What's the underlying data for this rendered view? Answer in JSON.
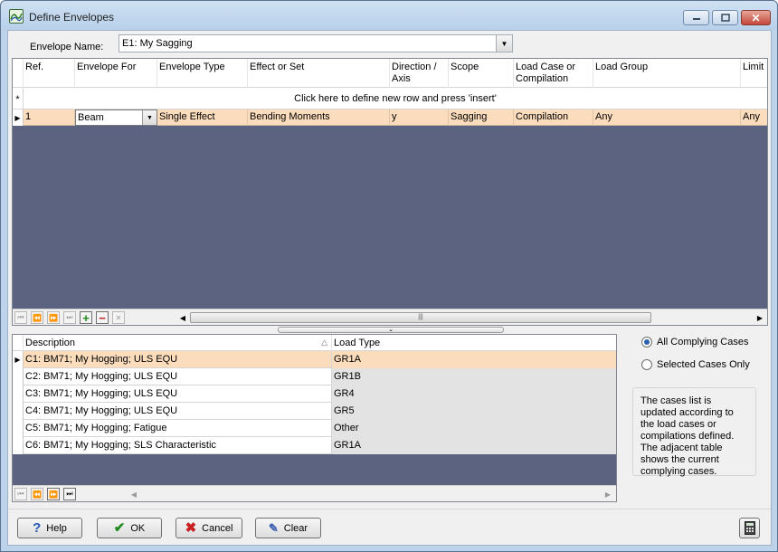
{
  "window": {
    "title": "Define Envelopes"
  },
  "envelope": {
    "label": "Envelope Name:",
    "value": "E1: My Sagging"
  },
  "envelopes_grid": {
    "columns": [
      "Ref.",
      "Envelope For",
      "Envelope Type",
      "Effect or Set",
      "Direction / Axis",
      "Scope",
      "Load Case or Compilation",
      "Load Group",
      "Limit S"
    ],
    "new_row_text": "Click here to define new row and press 'insert'",
    "new_row_marker": "*",
    "rows": [
      {
        "ref": "1",
        "envelope_for": "Beam",
        "envelope_type": "Single Effect",
        "effect": "Bending Moments",
        "direction": "y",
        "scope": "Sagging",
        "load_case": "Compilation",
        "load_group": "Any",
        "limit": "Any"
      }
    ]
  },
  "cases_grid": {
    "columns": [
      "Description",
      "Load Type"
    ],
    "rows": [
      {
        "description": "C1: BM71; My Hogging; ULS EQU",
        "load_type": "GR1A"
      },
      {
        "description": "C2: BM71; My Hogging; ULS EQU",
        "load_type": "GR1B"
      },
      {
        "description": "C3: BM71; My Hogging; ULS EQU",
        "load_type": "GR4"
      },
      {
        "description": "C4: BM71; My Hogging; ULS EQU",
        "load_type": "GR5"
      },
      {
        "description": "C5: BM71; My Hogging; Fatigue",
        "load_type": "Other"
      },
      {
        "description": "C6: BM71; My Hogging; SLS Characteristic",
        "load_type": "GR1A"
      }
    ]
  },
  "options": {
    "all_cases": "All Complying Cases",
    "selected_cases": "Selected Cases Only",
    "selected": "all_cases"
  },
  "info_text": "The cases list is updated according to the load cases or compilations defined.  The adjacent table shows the current complying cases.",
  "buttons": {
    "help": "Help",
    "ok": "OK",
    "cancel": "Cancel",
    "clear": "Clear"
  },
  "colors": {
    "grid_background": "#5c6381",
    "selected_row": "#fbdcbc",
    "window_frame": "#bcd3ea"
  }
}
